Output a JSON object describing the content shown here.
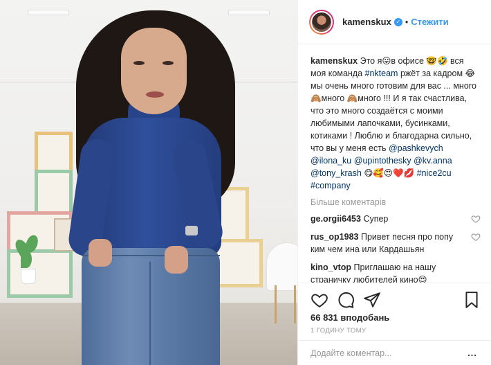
{
  "header": {
    "username": "kamenskux",
    "separator": "•",
    "follow_label": "Стежити"
  },
  "caption": {
    "username": "kamenskux",
    "part1": "Это я😛в офисе 🤓🤣 вся моя команда ",
    "tag_nkteam": "#nkteam",
    "part2": " ржёт за кадром 😂 мы очень много готовим для вас ... много 🙈много 🙈много !!! И я так счастлива, что это много создаётся с моими любимыми лапочками, бусинками, котиками ! Люблю и благодарна сильно, что вы у меня есть ",
    "mentions": [
      "@pashkevych",
      "@ilona_ku",
      "@upintothesky",
      "@kv.anna",
      "@tony_krash"
    ],
    "emojis": "😋🥰😍❤️💋",
    "tags": [
      "#nice2cu",
      "#company"
    ]
  },
  "more_comments_label": "Більше коментарів",
  "comments": [
    {
      "username": "ge.orgii6453",
      "text": "Супер"
    },
    {
      "username": "rus_op1983",
      "text": "Привет песня про попу ким чем ина или Кардашьян"
    },
    {
      "username": "kino_vtop",
      "text": "Приглашаю на нашу страничку любителей кино😍 страничка еще совсем новая,но у нас много интересного😉"
    }
  ],
  "likes": "66 831 вподобань",
  "time_ago": "1 годину тому",
  "comment_placeholder": "Додайте коментар...",
  "more_label": "...",
  "icons": {
    "verified": "verified-check-icon",
    "like": "heart-icon",
    "comment": "speech-bubble-icon",
    "share": "paper-plane-icon",
    "save": "bookmark-icon"
  },
  "colors": {
    "link": "#003569",
    "follow": "#3897f0",
    "muted": "#999999"
  }
}
